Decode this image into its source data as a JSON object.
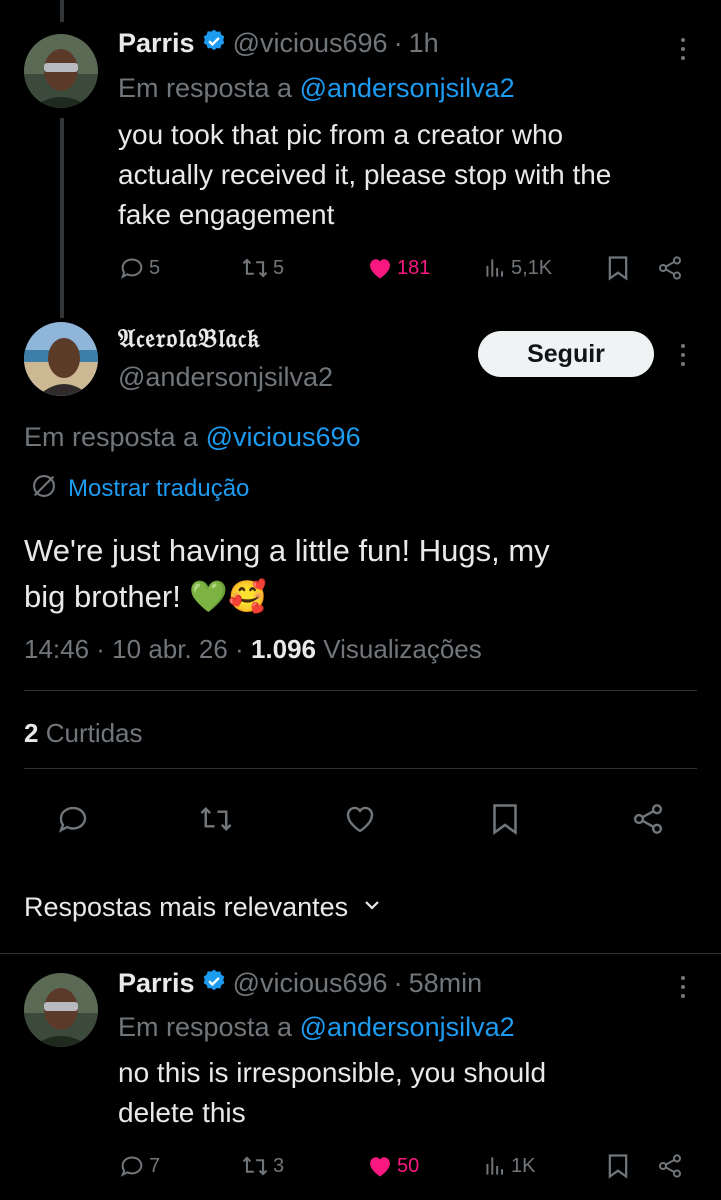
{
  "tweet1": {
    "name": "Parris",
    "handle": "@vicious696",
    "sep": "·",
    "time": "1h",
    "reply_prefix": "Em resposta a",
    "reply_handle": "@andersonjsilva2",
    "lines": [
      "you took that pic from a creator who",
      "actually received it, please stop with the",
      "fake engagement"
    ],
    "replies": "5",
    "retweets": "5",
    "likes": "181",
    "views": "5,1K"
  },
  "main": {
    "display_name": "𝔄𝔠𝔢𝔯𝔬𝔩𝔞𝔅𝔩𝔞𝔠𝔨",
    "handle": "@andersonjsilva2",
    "follow_label": "Seguir",
    "reply_prefix": "Em resposta a",
    "reply_handle": "@vicious696",
    "translate_label": "Mostrar tradução",
    "line1": "We're just having a little fun! Hugs, my",
    "line2": "big brother! 💚🥰",
    "timestamp": "14:46 · 10 abr. 26 ·",
    "views_count": "1.096",
    "views_label": "Visualizações",
    "likes_count": "2",
    "likes_label": "Curtidas"
  },
  "sort": {
    "label": "Respostas mais relevantes"
  },
  "tweet2": {
    "name": "Parris",
    "handle": "@vicious696",
    "sep": "·",
    "time": "58min",
    "reply_prefix": "Em resposta a",
    "reply_handle": "@andersonjsilva2",
    "lines": [
      "no this is irresponsible, you should",
      "delete this"
    ],
    "replies": "7",
    "retweets": "3",
    "likes": "50",
    "views": "1K"
  },
  "colors": {
    "background": "#000000",
    "text": "#e7e9ea",
    "muted": "#71767b",
    "link": "#1d9bf0",
    "like": "#f91880",
    "verified": "#1d9bf0"
  }
}
